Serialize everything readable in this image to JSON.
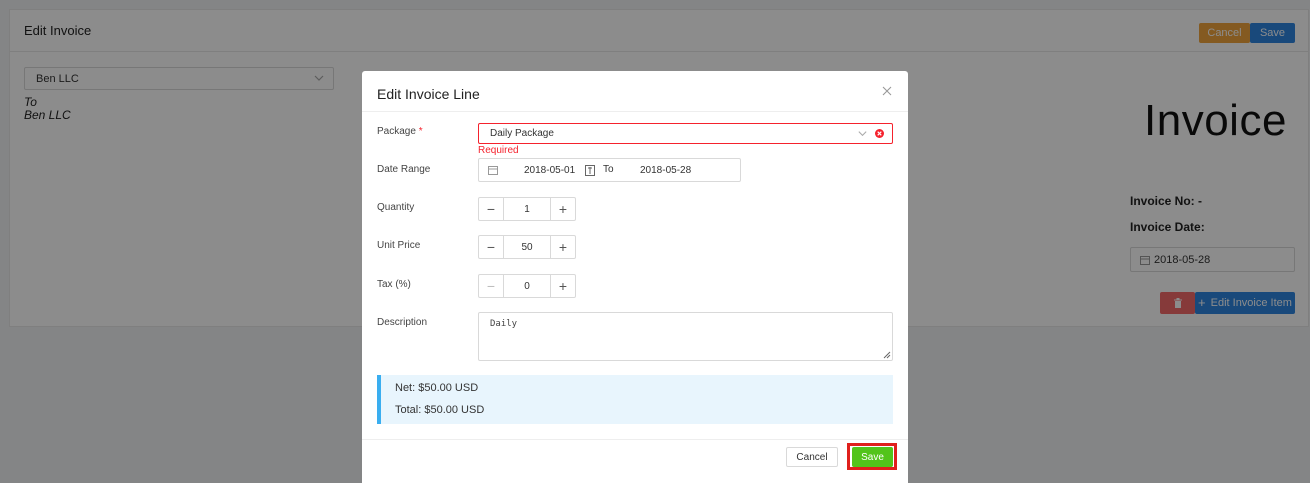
{
  "page": {
    "title": "Edit Invoice",
    "header_cancel": "Cancel",
    "header_save": "Save",
    "client_select_value": "Ben LLC",
    "to_label": "To",
    "to_name": "Ben LLC",
    "invoice_heading": "Invoice",
    "invoice_no": "Invoice No: -",
    "invoice_date_label": "Invoice Date:",
    "invoice_date_value": "2018-05-28",
    "edit_item_label": "Edit Invoice Item"
  },
  "modal": {
    "title": "Edit Invoice Line",
    "package": {
      "label": "Package",
      "required_mark": "*",
      "value": "Daily Package",
      "error": "Required"
    },
    "date_range": {
      "label": "Date Range",
      "start": "2018-05-01",
      "separator": "To",
      "end": "2018-05-28"
    },
    "quantity": {
      "label": "Quantity",
      "value": "1"
    },
    "unit_price": {
      "label": "Unit Price",
      "value": "50"
    },
    "tax": {
      "label": "Tax (%)",
      "value": "0"
    },
    "description": {
      "label": "Description",
      "value": "Daily"
    },
    "summary": {
      "net": "Net: $50.00 USD",
      "total": "Total: $50.00 USD"
    },
    "cancel_label": "Cancel",
    "save_label": "Save"
  },
  "colors": {
    "cancel_orange": "#f0a53c",
    "primary_blue": "#2f86e0",
    "danger_red": "#f5222d",
    "save_green": "#52c41a",
    "highlight_frame": "#e0201c",
    "info_bg": "#e8f5fd"
  }
}
